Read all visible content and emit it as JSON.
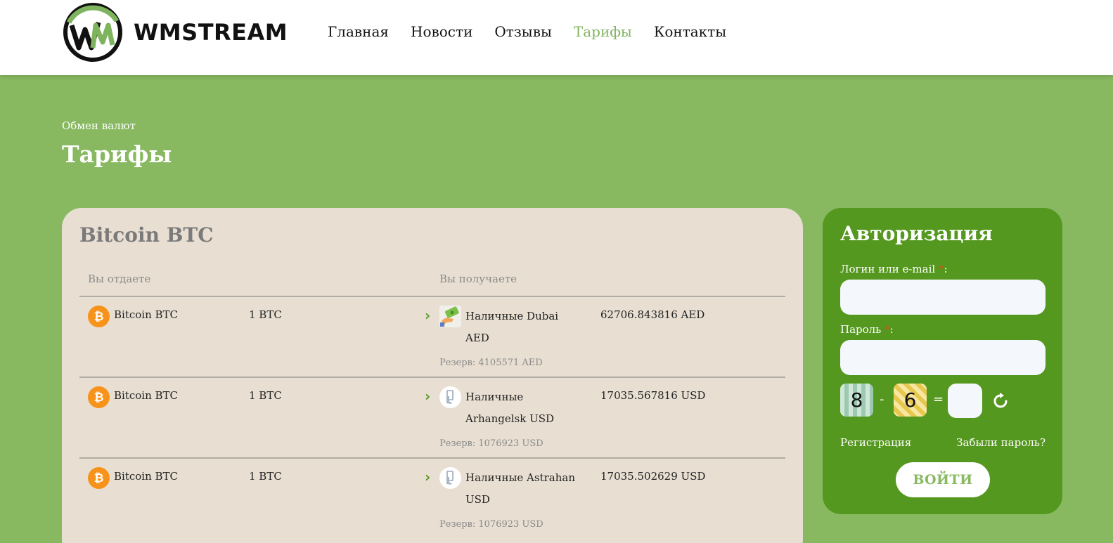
{
  "brand": {
    "name": "WMSTREAM",
    "logo_letters": "WM"
  },
  "nav": [
    {
      "label": "Главная",
      "active": false
    },
    {
      "label": "Новости",
      "active": false
    },
    {
      "label": "Отзывы",
      "active": false
    },
    {
      "label": "Тарифы",
      "active": true
    },
    {
      "label": "Контакты",
      "active": false
    }
  ],
  "breadcrumb": "Обмен валют",
  "page_title": "Тарифы",
  "rates": {
    "title": "Bitcoin BTC",
    "col_give": "Вы отдаете",
    "col_get": "Вы получаете",
    "rows": [
      {
        "give_name": "Bitcoin BTC",
        "give_amount": "1 BTC",
        "get_name": "Наличные Dubai AED",
        "get_amount": "62706.843816 AED",
        "reserve": "Резерв: 4105571 AED",
        "icon": "cash-hand-icon"
      },
      {
        "give_name": "Bitcoin BTC",
        "give_amount": "1 BTC",
        "get_name": "Наличные Arhangelsk USD",
        "get_amount": "17035.567816 USD",
        "reserve": "Резерв: 1076923 USD",
        "icon": "cash-card-icon"
      },
      {
        "give_name": "Bitcoin BTC",
        "give_amount": "1 BTC",
        "get_name": "Наличные Astrahan USD",
        "get_amount": "17035.502629 USD",
        "reserve": "Резерв: 1076923 USD",
        "icon": "cash-card-icon"
      }
    ]
  },
  "auth": {
    "title": "Авторизация",
    "login_label": "Логин или e-mail ",
    "password_label": "Пароль ",
    "required_mark": "*",
    "colon": ":",
    "captcha_a": "8",
    "captcha_op": "-",
    "captcha_b": "6",
    "captcha_eq": "=",
    "register_link": "Регистрация",
    "forgot_link": "Забыли пароль?",
    "login_button": "ВОЙТИ"
  },
  "colors": {
    "accent_green": "#88b961",
    "panel_green": "#55981f",
    "card_bg": "#e8dfd2",
    "bitcoin_orange": "#f7931a"
  }
}
